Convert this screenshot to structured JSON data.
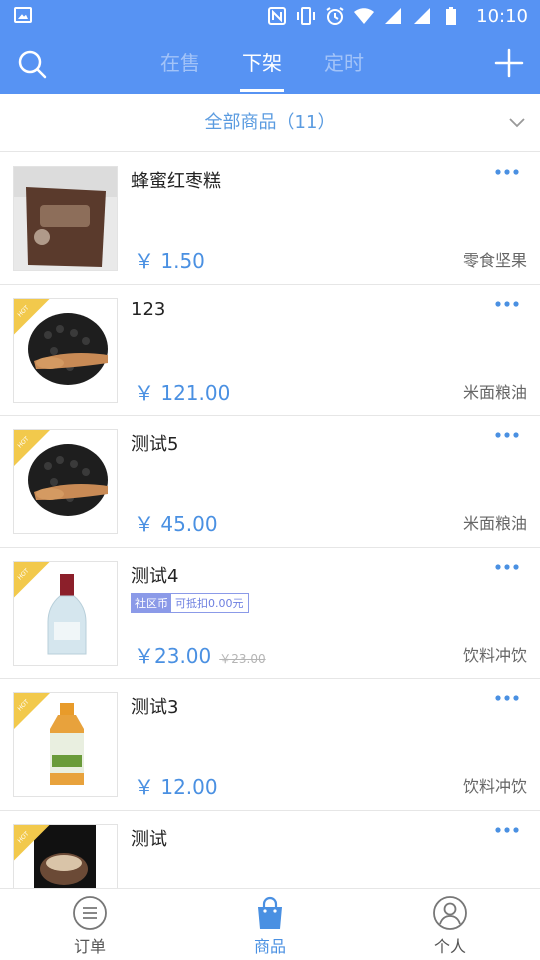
{
  "status_bar": {
    "time": "10:10",
    "icons": [
      "image-icon",
      "nfc-icon",
      "vibrate-icon",
      "alarm-icon",
      "wifi-icon",
      "signal-icon",
      "signal-icon",
      "battery-icon"
    ]
  },
  "header": {
    "tabs": [
      {
        "label": "在售",
        "active": false
      },
      {
        "label": "下架",
        "active": true
      },
      {
        "label": "定时",
        "active": false
      }
    ],
    "accent": "#5793f3"
  },
  "filter": {
    "label": "全部商品（11）"
  },
  "products": [
    {
      "name": "蜂蜜红枣糕",
      "price": "￥ 1.50",
      "category": "零食坚果",
      "hot": false,
      "image": "cake"
    },
    {
      "name": "123",
      "price": "￥ 121.00",
      "category": "米面粮油",
      "hot": true,
      "image": "beans"
    },
    {
      "name": "测试5",
      "price": "￥ 45.00",
      "category": "米面粮油",
      "hot": true,
      "image": "beans"
    },
    {
      "name": "测试4",
      "price": "￥23.00",
      "old_price": "￥23.00",
      "category": "饮料冲饮",
      "hot": true,
      "image": "bottle",
      "coupon": {
        "tag": "社区币",
        "text": "可抵扣0.00元"
      }
    },
    {
      "name": "测试3",
      "price": "￥ 12.00",
      "category": "饮料冲饮",
      "hot": true,
      "image": "tea"
    },
    {
      "name": "测试",
      "price": "",
      "category": "",
      "hot": true,
      "image": "dessert"
    }
  ],
  "hot_label": "HOT",
  "bottom_nav": [
    {
      "label": "订单",
      "icon": "list-icon",
      "active": false
    },
    {
      "label": "商品",
      "icon": "bag-icon",
      "active": true
    },
    {
      "label": "个人",
      "icon": "person-icon",
      "active": false
    }
  ]
}
